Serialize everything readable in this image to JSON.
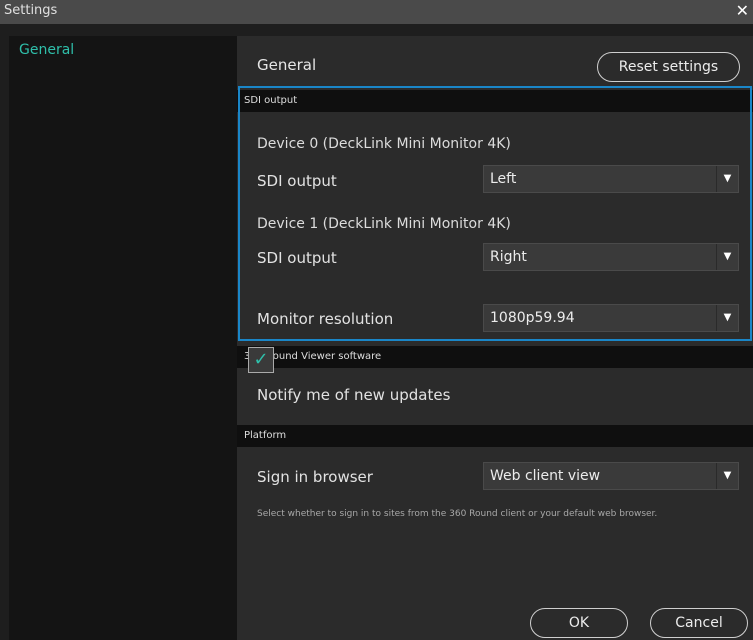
{
  "window": {
    "title": "Settings",
    "close_glyph": "✕"
  },
  "sidebar": {
    "items": [
      {
        "label": "General",
        "selected": true
      }
    ]
  },
  "main": {
    "heading": "General",
    "reset_button": "Reset settings",
    "sections": {
      "sdi": {
        "header": "SDI output",
        "device0_title": "Device 0 (DeckLink Mini Monitor 4K)",
        "device0_label": "SDI output",
        "device0_value": "Left",
        "device1_title": "Device 1 (DeckLink Mini Monitor 4K)",
        "device1_label": "SDI output",
        "device1_value": "Right",
        "monitor_label": "Monitor resolution",
        "monitor_value": "1080p59.94"
      },
      "software": {
        "header": "360 Round Viewer software",
        "notify_label": "Notify me of new updates",
        "notify_checked": true,
        "check_glyph": "✓"
      },
      "platform": {
        "header": "Platform",
        "signin_label": "Sign in browser",
        "signin_value": "Web client view",
        "hint": "Select whether to sign in to sites from the 360 Round client or your default web browser."
      }
    },
    "dropdown_glyph": "▼",
    "ok_button": "OK",
    "cancel_button": "Cancel"
  },
  "colors": {
    "accent": "#2fbfaa",
    "highlight_border": "#1a86c8",
    "section_header_bg": "#0f0f0f",
    "panel_bg": "#2b2b2b"
  },
  "icons": {
    "close": "close-icon",
    "dropdown": "chevron-down-icon",
    "check": "check-icon"
  }
}
